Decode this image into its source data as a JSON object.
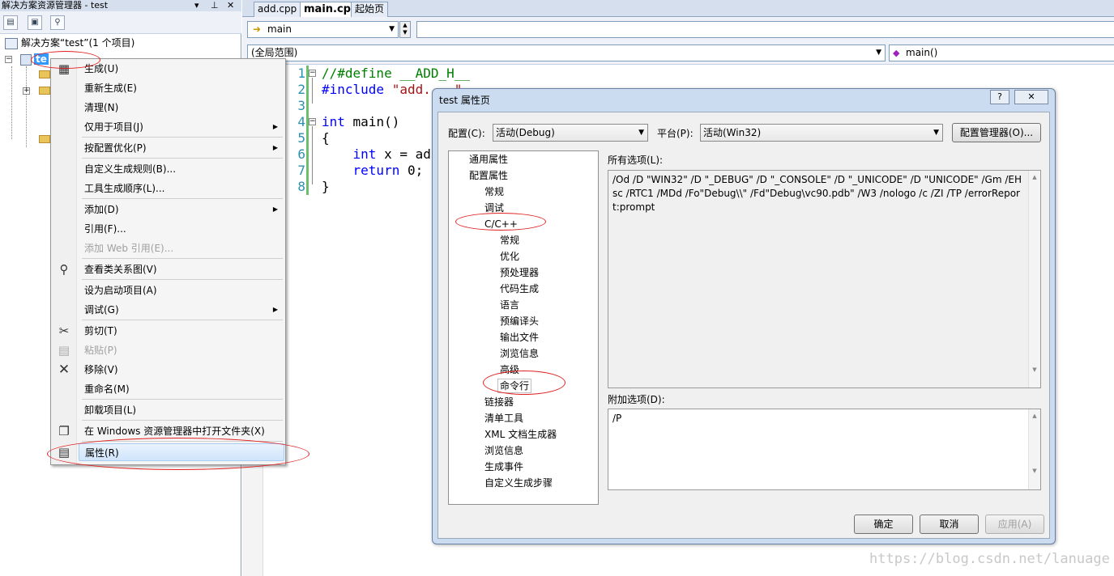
{
  "solution_explorer": {
    "title": "解决方案资源管理器 - test",
    "pin": "▾ ⊥ ✕",
    "root_label": "解决方案“test”(1 个项目)",
    "project_label": "te"
  },
  "tabs": [
    {
      "label": "add.cpp"
    },
    {
      "label": "main.cpp"
    },
    {
      "label": "起始页"
    }
  ],
  "navbar": {
    "combo_main": "main",
    "scope": "(全局范围)",
    "function": "main()"
  },
  "code": {
    "line_numbers": [
      "1",
      "2",
      "3",
      "4",
      "5",
      "6",
      "7",
      "8"
    ],
    "lines": {
      "l1": "//#define __ADD_H__",
      "l2_pp": "#include",
      "l2_str": " \"add.   \"",
      "l4_kw": "int",
      "l4_rest": " main()",
      "l5": "{",
      "l6_kw": "    int",
      "l6_rest": " x = ad",
      "l7_kw": "    return",
      "l7_rest": " 0;",
      "l8": "}"
    }
  },
  "context_menu": {
    "items": [
      {
        "label": "生成(U)"
      },
      {
        "label": "重新生成(E)"
      },
      {
        "label": "清理(N)"
      },
      {
        "label": "仅用于项目(J)"
      },
      {
        "label": "按配置优化(P)"
      },
      {
        "label": "自定义生成规则(B)..."
      },
      {
        "label": "工具生成顺序(L)..."
      },
      {
        "label": "添加(D)"
      },
      {
        "label": "引用(F)..."
      },
      {
        "label": "添加 Web 引用(E)..."
      },
      {
        "label": "查看类关系图(V)"
      },
      {
        "label": "设为启动项目(A)"
      },
      {
        "label": "调试(G)"
      },
      {
        "label": "剪切(T)"
      },
      {
        "label": "粘贴(P)"
      },
      {
        "label": "移除(V)"
      },
      {
        "label": "重命名(M)"
      },
      {
        "label": "卸载项目(L)"
      },
      {
        "label": "在 Windows 资源管理器中打开文件夹(X)"
      },
      {
        "label": "属性(R)"
      }
    ]
  },
  "dialog": {
    "title": "test 属性页",
    "help": "?",
    "close": "✕",
    "config_label": "配置(C):",
    "config_value": "活动(Debug)",
    "platform_label": "平台(P):",
    "platform_value": "活动(Win32)",
    "config_manager_button": "配置管理器(O)...",
    "tree": {
      "general": "通用属性",
      "config_props": "配置属性",
      "cp_general": "常规",
      "cp_debug": "调试",
      "cpp": "C/C++",
      "cpp_items": [
        "常规",
        "优化",
        "预处理器",
        "代码生成",
        "语言",
        "预编译头",
        "输出文件",
        "浏览信息",
        "高级",
        "命令行"
      ],
      "rest": [
        "链接器",
        "清单工具",
        "XML 文档生成器",
        "浏览信息",
        "生成事件",
        "自定义生成步骤"
      ]
    },
    "all_options_label": "所有选项(L):",
    "all_options_value": "/Od /D \"WIN32\" /D \"_DEBUG\" /D \"_CONSOLE\" /D \"_UNICODE\" /D \"UNICODE\" /Gm /EHsc /RTC1 /MDd /Fo\"Debug\\\\\" /Fd\"Debug\\vc90.pdb\" /W3 /nologo /c /ZI /TP /errorReport:prompt",
    "additional_label": "附加选项(D):",
    "additional_value": "/P",
    "ok": "确定",
    "cancel": "取消",
    "apply": "应用(A)"
  },
  "watermark": "https://blog.csdn.net/lanuage"
}
